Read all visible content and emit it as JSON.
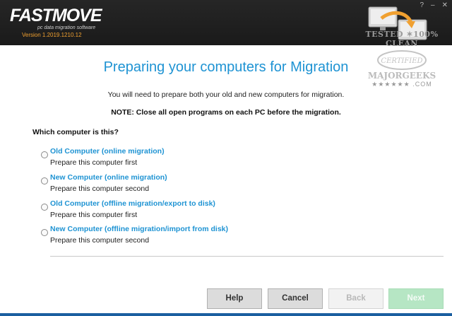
{
  "header": {
    "brand_a": "FAST",
    "brand_b": "MOVE",
    "tagline": "pc data migration software",
    "version": "Version 1.2019.1210.12",
    "help_glyph": "?",
    "minimize_glyph": "–",
    "close_glyph": "✕"
  },
  "watermark": {
    "top": "TESTED ✶100% CLEAN",
    "mid": "MAJORGEEKS",
    "ring": "CERTIFIED",
    "bottom": "★★★★★★ .COM"
  },
  "main": {
    "title": "Preparing your computers for Migration",
    "intro": "You will need to prepare both your old and new computers for migration.",
    "note": "NOTE: Close all open programs on each PC before the migration.",
    "question": "Which computer is this?",
    "options": [
      {
        "title": "Old Computer (online migration)",
        "subtitle": "Prepare this computer first"
      },
      {
        "title": "New Computer (online migration)",
        "subtitle": "Prepare this computer second"
      },
      {
        "title": "Old Computer (offline migration/export to disk)",
        "subtitle": "Prepare this computer first"
      },
      {
        "title": "New Computer (offline migration/import from disk)",
        "subtitle": "Prepare this computer second"
      }
    ]
  },
  "footer": {
    "help_label": "Help",
    "cancel_label": "Cancel",
    "back_label": "Back",
    "next_label": "Next"
  },
  "colors": {
    "accent": "#1e93d3",
    "header_bg": "#1f1f1f",
    "brand_orange": "#f0a030",
    "next_disabled": "#b6e6c4"
  }
}
